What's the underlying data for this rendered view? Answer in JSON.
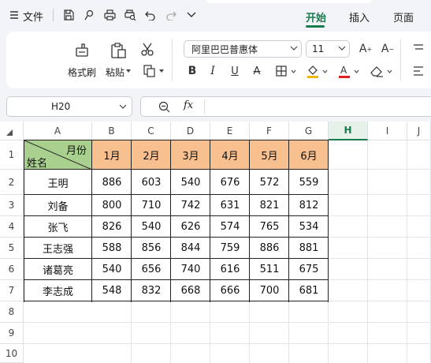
{
  "app": {
    "menu_label": "文件",
    "tabs": [
      {
        "label": "开始",
        "active": true
      },
      {
        "label": "插入",
        "active": false
      },
      {
        "label": "页面",
        "active": false
      }
    ],
    "accent_color": "#1a7b4f"
  },
  "ribbon": {
    "format_painter_label": "格式刷",
    "paste_label": "粘贴",
    "font_name": "阿里巴巴普惠体",
    "font_size": "11",
    "font_color_bar": "#e02020",
    "fill_color_bar": "#f2b705"
  },
  "formula_bar": {
    "name_box": "H20",
    "fx_label": "fx",
    "formula": ""
  },
  "sheet": {
    "columns": [
      "A",
      "B",
      "C",
      "D",
      "E",
      "F",
      "G",
      "H",
      "I",
      "J"
    ],
    "rows": [
      "1",
      "2",
      "3",
      "4",
      "5",
      "6",
      "7",
      "8",
      "9",
      "10"
    ],
    "header_fill": "#f9c08f",
    "corner_fill": "#a9d08e",
    "corner_top": "月份",
    "corner_bottom": "姓名",
    "months": [
      "1月",
      "2月",
      "3月",
      "4月",
      "5月",
      "6月"
    ],
    "records": [
      {
        "name": "王明",
        "values": [
          "886",
          "603",
          "540",
          "676",
          "572",
          "559"
        ]
      },
      {
        "name": "刘备",
        "values": [
          "800",
          "710",
          "742",
          "631",
          "821",
          "812"
        ]
      },
      {
        "name": "张飞",
        "values": [
          "826",
          "540",
          "626",
          "574",
          "765",
          "534"
        ]
      },
      {
        "name": "王志强",
        "values": [
          "588",
          "856",
          "844",
          "759",
          "886",
          "881"
        ]
      },
      {
        "name": "诸葛亮",
        "values": [
          "540",
          "656",
          "740",
          "616",
          "511",
          "675"
        ]
      },
      {
        "name": "李志成",
        "values": [
          "548",
          "832",
          "668",
          "666",
          "700",
          "681"
        ]
      }
    ]
  }
}
